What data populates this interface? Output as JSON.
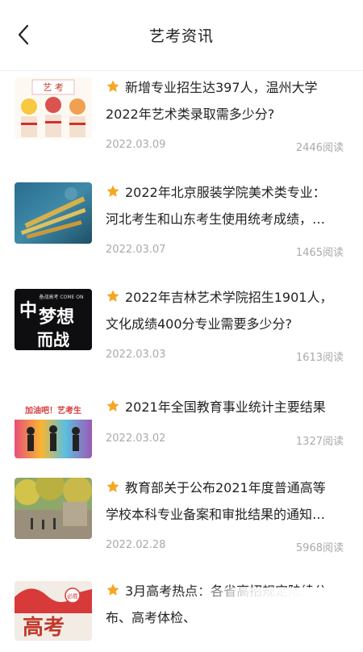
{
  "header": {
    "title": "艺考资讯"
  },
  "articles": [
    {
      "line1": "新增专业招生达397人，温州大学",
      "line2": "2022年艺术类录取需多少分?",
      "date": "2022.03.09",
      "views": "2446阅读",
      "thumb_text": "艺 考"
    },
    {
      "line1": "2022年北京服装学院美术类专业：",
      "line2": "河北考生和山东考生使用统考成绩，…",
      "date": "2022.03.07",
      "views": "1465阅读"
    },
    {
      "line1": "2022年吉林艺术学院招生1901人，",
      "line2": "文化成绩400分专业需要多少分?",
      "date": "2022.03.03",
      "views": "1613阅读",
      "thumb_text": "梦想",
      "thumb_text2": "而战",
      "thumb_small": "备战高考 COME ON"
    },
    {
      "line1": "2021年全国教育事业统计主要结果",
      "line2": "",
      "date": "2022.03.02",
      "views": "1327阅读",
      "thumb_text": "加油吧！艺考生"
    },
    {
      "line1": "教育部关于公布2021年度普通高等",
      "line2": "学校本科专业备案和审批结果的通知…",
      "date": "2022.02.28",
      "views": "5968阅读"
    },
    {
      "line1": "3月高考热点：各省高招规定陆续公",
      "line2": "布、高考体检、",
      "date": "",
      "views": "",
      "thumb_text": "高考",
      "thumb_small": "必胜"
    }
  ],
  "colors": {
    "star": "#f5a623",
    "text": "#222222",
    "meta": "#aaaaaa"
  }
}
